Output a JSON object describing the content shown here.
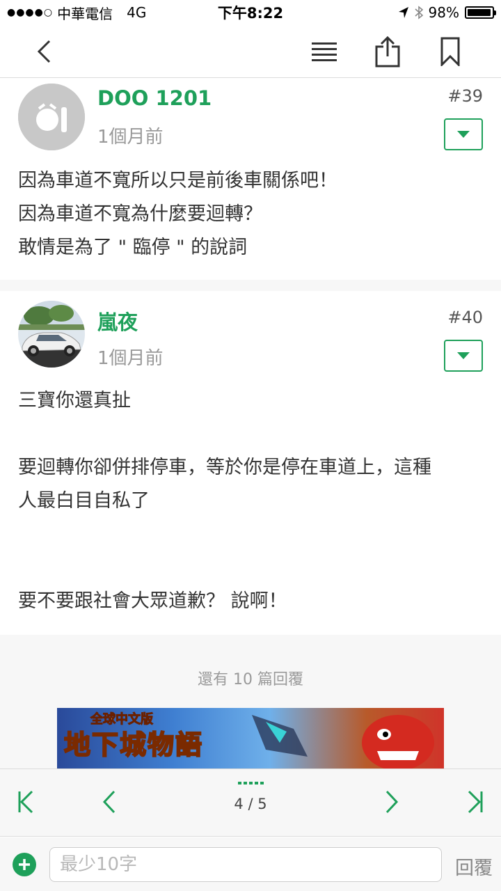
{
  "status_bar": {
    "carrier": "中華電信",
    "network": "4G",
    "time": "下午8:22",
    "battery": "98%",
    "battery_level": 0.98
  },
  "nav": {
    "back_icon": "chevron-left-icon",
    "menu_icon": "hamburger-icon",
    "share_icon": "share-icon",
    "bookmark_icon": "bookmark-icon"
  },
  "posts": [
    {
      "username": "DOO 1201",
      "time": "1個月前",
      "floor": "#39",
      "lines": [
        "因為車道不寬所以只是前後車關係吧！",
        "因為車道不寬為什麼要迴轉？",
        "敢情是為了 \" 臨停 \" 的說詞"
      ]
    },
    {
      "username": "嵐夜",
      "time": "1個月前",
      "floor": "#40",
      "lines": [
        "三寶你還真扯",
        "",
        "要迴轉你卻併排停車，等於你是停在車道上，這種",
        "人最白目自私了",
        "",
        "",
        "要不要跟社會大眾道歉？ 說啊！"
      ]
    }
  ],
  "more_replies": "還有 10 篇回覆",
  "ad": {
    "title": "地下城物語",
    "subtitle": "全球中文版"
  },
  "pager": {
    "current": "4 / 5"
  },
  "reply_bar": {
    "placeholder": "最少10字",
    "submit": "回覆"
  },
  "colors": {
    "accent": "#1ea05a"
  }
}
